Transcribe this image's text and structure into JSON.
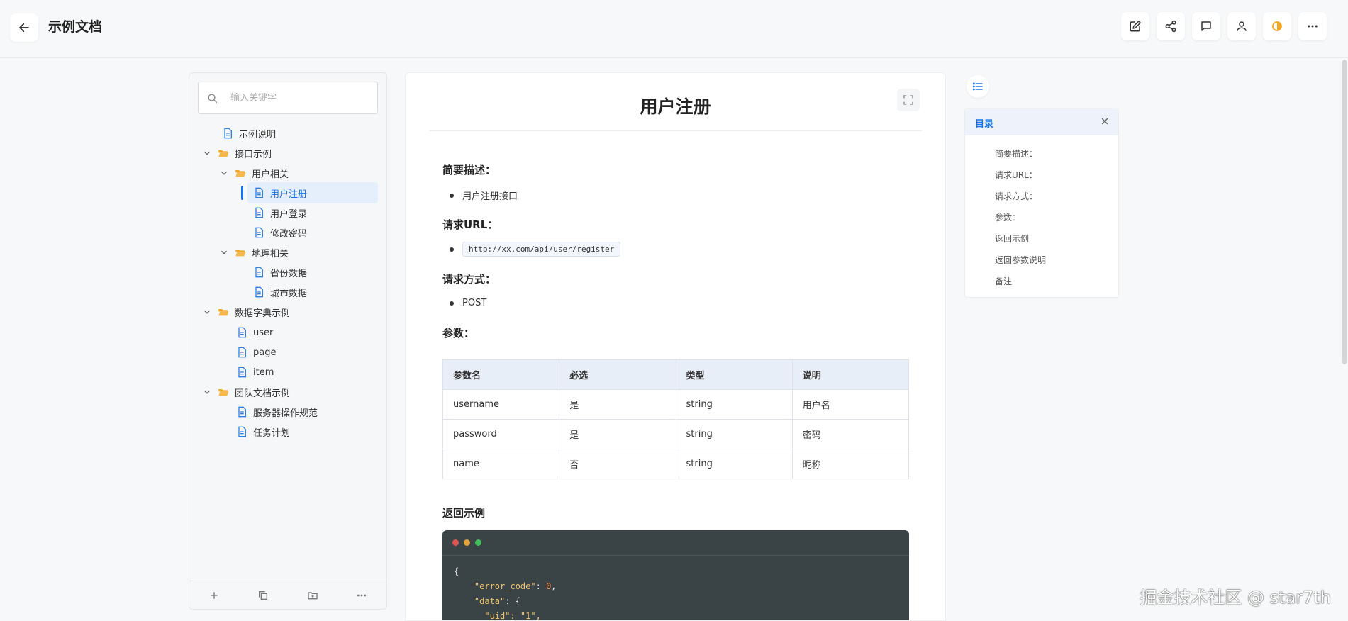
{
  "header": {
    "title": "示例文档",
    "actions": [
      "edit-icon",
      "share-icon",
      "comment-icon",
      "user-icon",
      "theme-icon",
      "more-icon"
    ]
  },
  "sidebar": {
    "search_placeholder": "输入关键字",
    "items": [
      {
        "label": "示例说明",
        "type": "doc"
      },
      {
        "label": "接口示例",
        "type": "folder"
      },
      {
        "label": "用户相关",
        "type": "folder"
      },
      {
        "label": "用户注册",
        "type": "doc",
        "active": true
      },
      {
        "label": "用户登录",
        "type": "doc"
      },
      {
        "label": "修改密码",
        "type": "doc"
      },
      {
        "label": "地理相关",
        "type": "folder"
      },
      {
        "label": "省份数据",
        "type": "doc"
      },
      {
        "label": "城市数据",
        "type": "doc"
      },
      {
        "label": "数据字典示例",
        "type": "folder"
      },
      {
        "label": "user",
        "type": "doc"
      },
      {
        "label": "page",
        "type": "doc"
      },
      {
        "label": "item",
        "type": "doc"
      },
      {
        "label": "团队文档示例",
        "type": "folder"
      },
      {
        "label": "服务器操作规范",
        "type": "doc"
      },
      {
        "label": "任务计划",
        "type": "doc"
      }
    ],
    "footer": [
      "plus-icon",
      "copy-icon",
      "folder-add-icon",
      "more-icon"
    ]
  },
  "doc": {
    "title": "用户注册",
    "sections": {
      "desc_h": "简要描述：",
      "desc_item": "用户注册接口",
      "url_h": "请求URL：",
      "url_item": "http://xx.com/api/user/register",
      "method_h": "请求方式：",
      "method_item": "POST",
      "params_h": "参数：",
      "return_h": "返回示例"
    },
    "params_table": {
      "headers": [
        "参数名",
        "必选",
        "类型",
        "说明"
      ],
      "rows": [
        [
          "username",
          "是",
          "string",
          "用户名"
        ],
        [
          "password",
          "是",
          "string",
          "密码"
        ],
        [
          "name",
          "否",
          "string",
          "昵称"
        ]
      ]
    },
    "code": {
      "line1": "{",
      "line2_key": "\"error_code\"",
      "line2_val": "0",
      "line3_key": "\"data\"",
      "line3_rest": ": {",
      "line4": "\"uid\": \"1\","
    }
  },
  "toc": {
    "title": "目录",
    "items": [
      "简要描述：",
      "请求URL：",
      "请求方式：",
      "参数：",
      "返回示例",
      "返回参数说明",
      "备注"
    ]
  },
  "watermark": "掘金技术社区 @ star7th",
  "colors": {
    "accent": "#1a73e8",
    "folder": "#f5a623",
    "doc": "#2f80ed",
    "theme": "#f5a623"
  }
}
